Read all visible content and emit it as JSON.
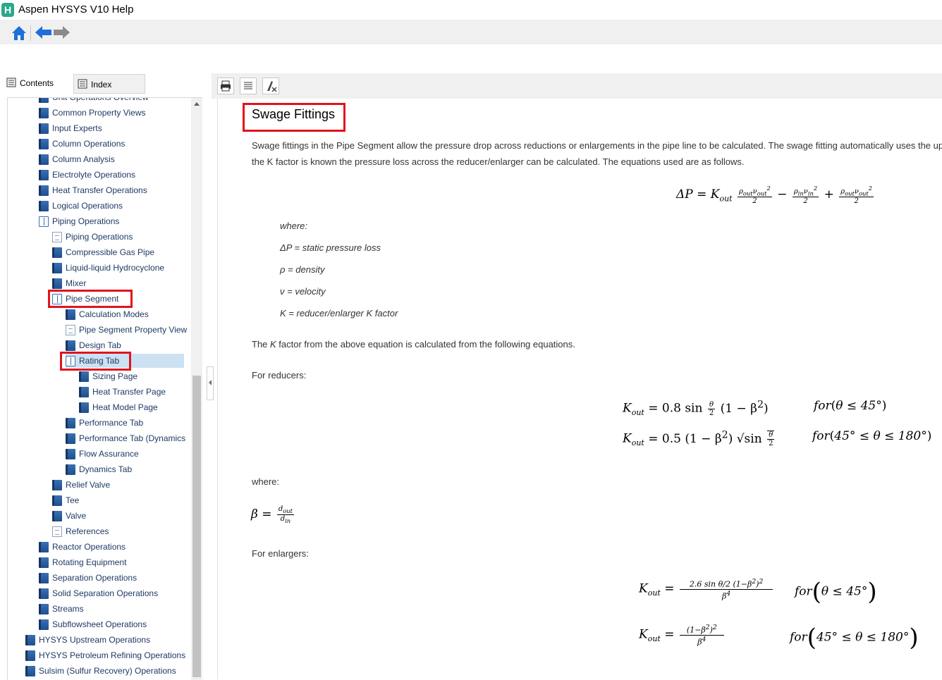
{
  "window": {
    "title": "Aspen HYSYS V10 Help",
    "app_icon": "H"
  },
  "nav_tabs": [
    {
      "label": "Contents",
      "icon": "contents-icon",
      "active": true
    },
    {
      "label": "Index",
      "icon": "index-icon",
      "active": false
    }
  ],
  "tree": [
    {
      "label": "Unit Operations Overview",
      "depth": 1,
      "icon": "book"
    },
    {
      "label": "Common Property Views",
      "depth": 1,
      "icon": "book"
    },
    {
      "label": "Input Experts",
      "depth": 1,
      "icon": "book"
    },
    {
      "label": "Column Operations",
      "depth": 1,
      "icon": "book"
    },
    {
      "label": "Column Analysis",
      "depth": 1,
      "icon": "book"
    },
    {
      "label": "Electrolyte Operations",
      "depth": 1,
      "icon": "book"
    },
    {
      "label": "Heat Transfer Operations",
      "depth": 1,
      "icon": "book"
    },
    {
      "label": "Logical Operations",
      "depth": 1,
      "icon": "book"
    },
    {
      "label": "Piping Operations",
      "depth": 1,
      "icon": "openbook"
    },
    {
      "label": "Piping Operations",
      "depth": 2,
      "icon": "page"
    },
    {
      "label": "Compressible Gas Pipe",
      "depth": 2,
      "icon": "book"
    },
    {
      "label": "Liquid-liquid Hydrocyclone",
      "depth": 2,
      "icon": "book"
    },
    {
      "label": "Mixer",
      "depth": 2,
      "icon": "book"
    },
    {
      "label": "Pipe Segment",
      "depth": 2,
      "icon": "openbook"
    },
    {
      "label": "Calculation Modes",
      "depth": 3,
      "icon": "book"
    },
    {
      "label": "Pipe Segment Property View",
      "depth": 3,
      "icon": "page"
    },
    {
      "label": "Design Tab",
      "depth": 3,
      "icon": "book"
    },
    {
      "label": "Rating Tab",
      "depth": 3,
      "icon": "openbook",
      "selected": true
    },
    {
      "label": "Sizing Page",
      "depth": 4,
      "icon": "book"
    },
    {
      "label": "Heat Transfer Page",
      "depth": 4,
      "icon": "book"
    },
    {
      "label": "Heat Model Page",
      "depth": 4,
      "icon": "book"
    },
    {
      "label": "Performance Tab",
      "depth": 3,
      "icon": "book"
    },
    {
      "label": "Performance Tab (Dynamics",
      "depth": 3,
      "icon": "book"
    },
    {
      "label": "Flow Assurance",
      "depth": 3,
      "icon": "book"
    },
    {
      "label": "Dynamics Tab",
      "depth": 3,
      "icon": "book"
    },
    {
      "label": "Relief Valve",
      "depth": 2,
      "icon": "book"
    },
    {
      "label": "Tee",
      "depth": 2,
      "icon": "book"
    },
    {
      "label": "Valve",
      "depth": 2,
      "icon": "book"
    },
    {
      "label": "References",
      "depth": 2,
      "icon": "page"
    },
    {
      "label": "Reactor Operations",
      "depth": 1,
      "icon": "book"
    },
    {
      "label": "Rotating Equipment",
      "depth": 1,
      "icon": "book"
    },
    {
      "label": "Separation Operations",
      "depth": 1,
      "icon": "book"
    },
    {
      "label": "Solid Separation Operations",
      "depth": 1,
      "icon": "book"
    },
    {
      "label": "Streams",
      "depth": 1,
      "icon": "book"
    },
    {
      "label": "Subflowsheet Operations",
      "depth": 1,
      "icon": "book"
    },
    {
      "label": "HYSYS Upstream Operations",
      "depth": 0,
      "icon": "book"
    },
    {
      "label": "HYSYS Petroleum Refining Operations",
      "depth": 0,
      "icon": "book"
    },
    {
      "label": "Sulsim (Sulfur Recovery) Operations",
      "depth": 0,
      "icon": "book"
    }
  ],
  "content": {
    "title": "Swage Fittings",
    "intro_line1": "Swage fittings in the Pipe Segment allow the pressure drop across reductions or enlargements in the pipe line to be calculated. The swage fitting automatically uses the up",
    "intro_line2": "the K factor is known the pressure loss across the reducer/enlarger can be calculated. The equations used are as follows.",
    "where1": "where:",
    "def_dp": "ΔP = static pressure loss",
    "def_rho": "ρ = density",
    "def_v": "ν = velocity",
    "def_k": "K = reducer/enlarger K factor",
    "kfactor_pre": "The ",
    "kfactor_k": "K",
    "kfactor_post": " factor from the above equation is calculated from the following equations.",
    "for_reducers": "For reducers:",
    "where2": "where:",
    "for_enlargers": "For enlargers:"
  }
}
